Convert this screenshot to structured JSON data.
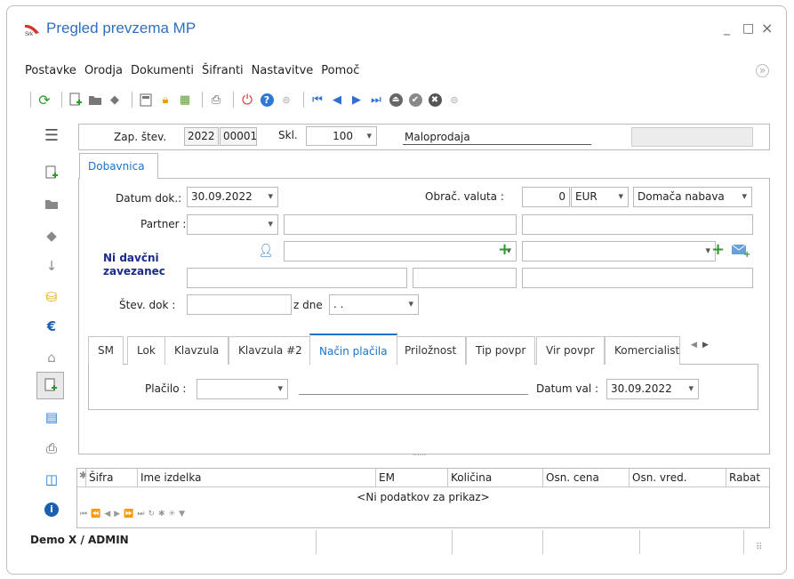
{
  "window": {
    "title": "Pregled prevzema MP",
    "minimize": "_",
    "maximize": "□",
    "close": "×"
  },
  "menu": [
    "Postavke",
    "Orodja",
    "Dokumenti",
    "Šifranti",
    "Nastavitve",
    "Pomoč"
  ],
  "header": {
    "zap_label": "Zap. štev.",
    "zap_year": "2022",
    "zap_num": "00001",
    "skl_label": "Skl.",
    "skl_value": "100",
    "maloprodaja": "Maloprodaja"
  },
  "tab_main": "Dobavnica",
  "form": {
    "datum_label": "Datum dok.:",
    "datum_value": "30.09.2022",
    "valuta_label": "Obrač. valuta :",
    "valuta_amount": "0",
    "valuta_cur": "EUR",
    "nabava": "Domača nabava",
    "partner_label": "Partner :",
    "davcni": "Ni davčni zavezanec",
    "stev_label": "Štev. dok :",
    "zdne_label": "z dne",
    "zdne_value": ". ."
  },
  "subtabs": [
    "SM",
    "Lok",
    "Klavzula",
    "Klavzula #2",
    "Način plačila",
    "Priložnost",
    "Tip povpr",
    "Vir povpr",
    "Komercialist"
  ],
  "active_subtab": "Način plačila",
  "placilo": {
    "label": "Plačilo :",
    "datum_val_label": "Datum val :",
    "datum_val": "30.09.2022"
  },
  "grid": {
    "columns": [
      "Šifra",
      "Ime izdelka",
      "EM",
      "Količina",
      "Osn. cena",
      "Osn. vred.",
      "Rabat"
    ],
    "empty": "<Ni podatkov za prikaz>",
    "dots": "......"
  },
  "status": {
    "user": "Demo X / ADMIN"
  },
  "colors": {
    "accent": "#2f6fbf",
    "tab_active": "#1a73c9",
    "dark_blue": "#1b2a8a"
  }
}
